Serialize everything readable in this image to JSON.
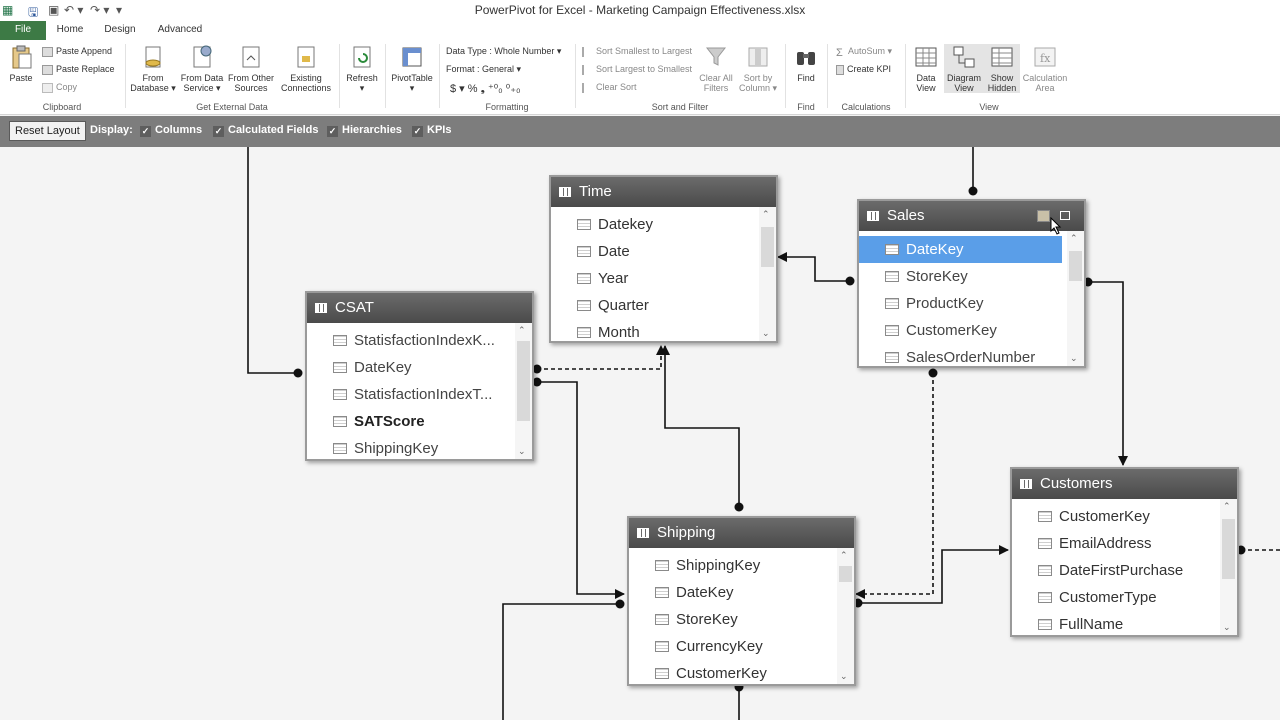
{
  "window": {
    "title": "PowerPivot for Excel - Marketing Campaign Effectiveness.xlsx",
    "quick_access": [
      "excel-icon",
      "save-icon",
      "undo-icon",
      "redo-icon",
      "customize-icon"
    ]
  },
  "tabs": [
    "File",
    "Home",
    "Design",
    "Advanced"
  ],
  "ribbon": {
    "clipboard": {
      "paste": "Paste",
      "paste_append": "Paste Append",
      "paste_replace": "Paste Replace",
      "copy": "Copy",
      "label": "Clipboard"
    },
    "external": {
      "from_database_1": "From",
      "from_database_2": "Database ▾",
      "from_data_service_1": "From Data",
      "from_data_service_2": "Service ▾",
      "from_other_1": "From Other",
      "from_other_2": "Sources",
      "existing_1": "Existing",
      "existing_2": "Connections",
      "label": "Get External Data"
    },
    "refresh": {
      "label": "Refresh",
      "arrow": "▾"
    },
    "pivottable": {
      "label": "PivotTable",
      "arrow": "▾"
    },
    "formatting": {
      "data_type": "Data Type : Whole Number ▾",
      "format": "Format : General ▾",
      "symbols": "$ ▾  %  ❟  ⁺⁰₀  ⁰₊₀",
      "label": "Formatting"
    },
    "sort": {
      "asc": "Sort Smallest to Largest",
      "desc": "Sort Largest to Smallest",
      "clear": "Clear Sort",
      "clear_filters_1": "Clear All",
      "clear_filters_2": "Filters",
      "sort_by_1": "Sort by",
      "sort_by_2": "Column ▾",
      "label": "Sort and Filter"
    },
    "find": {
      "button": "Find",
      "label": "Find"
    },
    "calculations": {
      "autosum": "AutoSum ▾",
      "kpi": "Create KPI",
      "label": "Calculations"
    },
    "view": {
      "data_1": "Data",
      "data_2": "View",
      "diagram_1": "Diagram",
      "diagram_2": "View",
      "hidden_1": "Show",
      "hidden_2": "Hidden",
      "calc_1": "Calculation",
      "calc_2": "Area",
      "label": "View"
    }
  },
  "display_bar": {
    "reset": "Reset Layout",
    "display_label": "Display:",
    "options": [
      {
        "label": "Columns",
        "checked": true
      },
      {
        "label": "Calculated Fields",
        "checked": true
      },
      {
        "label": "Hierarchies",
        "checked": true
      },
      {
        "label": "KPIs",
        "checked": true
      }
    ]
  },
  "tables": {
    "time": {
      "title": "Time",
      "columns": [
        "Datekey",
        "Date",
        "Year",
        "Quarter",
        "Month"
      ]
    },
    "sales": {
      "title": "Sales",
      "columns": [
        "DateKey",
        "StoreKey",
        "ProductKey",
        "CustomerKey",
        "SalesOrderNumber"
      ],
      "selected": "DateKey"
    },
    "csat": {
      "title": "CSAT",
      "columns": [
        "StatisfactionIndexK...",
        "DateKey",
        "StatisfactionIndexT...",
        "SATScore",
        "ShippingKey"
      ]
    },
    "customers": {
      "title": "Customers",
      "columns": [
        "CustomerKey",
        "EmailAddress",
        "DateFirstPurchase",
        "CustomerType",
        "FullName"
      ]
    },
    "shipping": {
      "title": "Shipping",
      "columns": [
        "ShippingKey",
        "DateKey",
        "StoreKey",
        "CurrencyKey",
        "CustomerKey"
      ]
    }
  }
}
